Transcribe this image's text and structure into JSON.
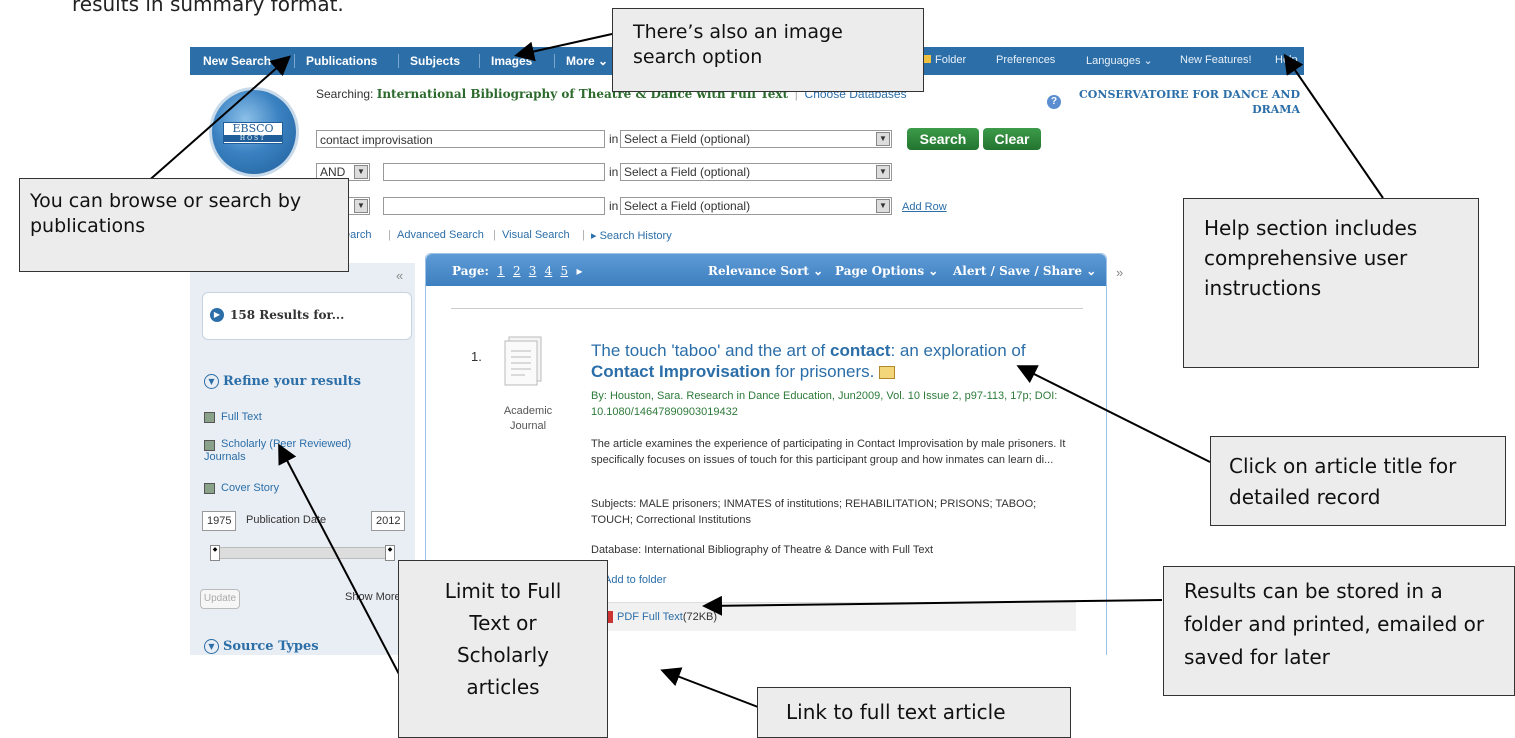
{
  "doc_text": "results in summary format.",
  "topnav": {
    "new_search": "New Search",
    "publications": "Publications",
    "subjects": "Subjects",
    "images": "Images",
    "more": "More ⌄",
    "folder": "Folder",
    "preferences": "Preferences",
    "languages": "Languages ⌄",
    "new_features": "New Features!",
    "help": "Help"
  },
  "logo": {
    "text": "EBSCO",
    "sub": "HOST"
  },
  "searching": {
    "label": "Searching:",
    "database": "International Bibliography of Theatre & Dance with Full Text",
    "choose": "Choose Databases"
  },
  "search": {
    "row1_value": "contact improvisation",
    "row2_bool": "AND",
    "in_label": "in",
    "field_placeholder": "Select a Field (optional)",
    "search_btn": "Search",
    "clear_btn": "Clear",
    "add_row": "Add Row"
  },
  "subnav": {
    "basic": "earch",
    "advanced": "Advanced Search",
    "visual": "Visual Search",
    "history": "▸ Search History"
  },
  "institution": "CONSERVATOIRE FOR DANCE AND DRAMA",
  "left": {
    "results": "158 Results for...",
    "refine": "Refine your results",
    "full_text": "Full Text",
    "scholarly": "Scholarly (Peer Reviewed) Journals",
    "cover_story": "Cover Story",
    "date_from": "1975",
    "pub_date": "Publication Date",
    "date_to": "2012",
    "update": "Update",
    "show_more": "Show More",
    "source_types": "Source Types"
  },
  "results_header": {
    "page_label": "Page:",
    "pages": [
      "1",
      "2",
      "3",
      "4",
      "5"
    ],
    "relevance": "Relevance Sort ⌄",
    "page_options": "Page Options ⌄",
    "alert": "Alert / Save / Share ⌄"
  },
  "result": {
    "num": "1.",
    "type": "Academic Journal",
    "title_a": "The touch 'taboo' and the art of ",
    "title_b": "contact",
    "title_c": ": an exploration of",
    "title_d": "Contact Improvisation",
    "title_e": " for prisoners.",
    "by": "By: Houston, Sara. Research in Dance Education, Jun2009, Vol. 10 Issue 2, p97-113, 17p; DOI: 10.1080/14647890903019432",
    "abstract": "The article examines the experience of participating in Contact Improvisation by male prisoners. It specifically focuses on issues of touch for this participant group and how inmates can learn di...",
    "subjects": "Subjects: MALE prisoners; INMATES of institutions; REHABILITATION; PRISONS; TABOO; TOUCH; Correctional Institutions",
    "database": "Database: International Bibliography of Theatre & Dance with Full Text",
    "add_folder": "Add to folder",
    "pdf": "PDF Full Text",
    "pdf_size": "(72KB)"
  },
  "callouts": {
    "image_search": "There’s also an image search option",
    "browse": "You can browse or search by publications",
    "help": "Help section includes comprehensive user instructions",
    "article_title": "Click on article title for detailed record",
    "folder": "Results can be stored in a folder and printed, emailed or saved for later",
    "limit": "Limit to Full Text or Scholarly articles",
    "fulltext_link": "Link to full text article"
  }
}
